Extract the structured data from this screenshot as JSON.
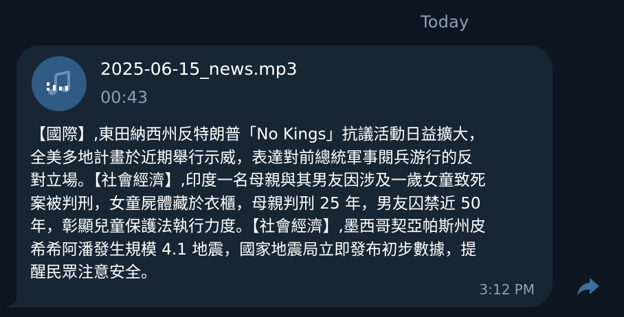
{
  "date_separator": "Today",
  "message": {
    "attachment": {
      "file_name": "2025-06-15_news.mp3",
      "duration": "00:43",
      "icon": "music-note-icon"
    },
    "text": "【國際】,東田納西州反特朗普「No Kings」抗議活動日益擴大，全美多地計畫於近期舉行示威，表達對前總統軍事閱兵游行的反對立場。【社會經濟】,印度一名母親與其男友因涉及一歲女童致死案被判刑，女童屍體藏於衣櫃，母親判刑 25 年，男友囚禁近 50 年，彰顯兒童保護法執行力度。【社會經濟】,墨西哥契亞帕斯州皮希希阿潘發生規模 4.1 地震，國家地震局立即發布初步數據，提醒民眾注意安全。",
    "time": "3:12 PM"
  },
  "actions": {
    "forward_icon": "forward-arrow-icon"
  },
  "colors": {
    "background": "#0e1621",
    "bubble": "#182533",
    "accent": "#2f5b85",
    "muted_text": "#8fa0b3",
    "forward": "#3d6e9c"
  }
}
